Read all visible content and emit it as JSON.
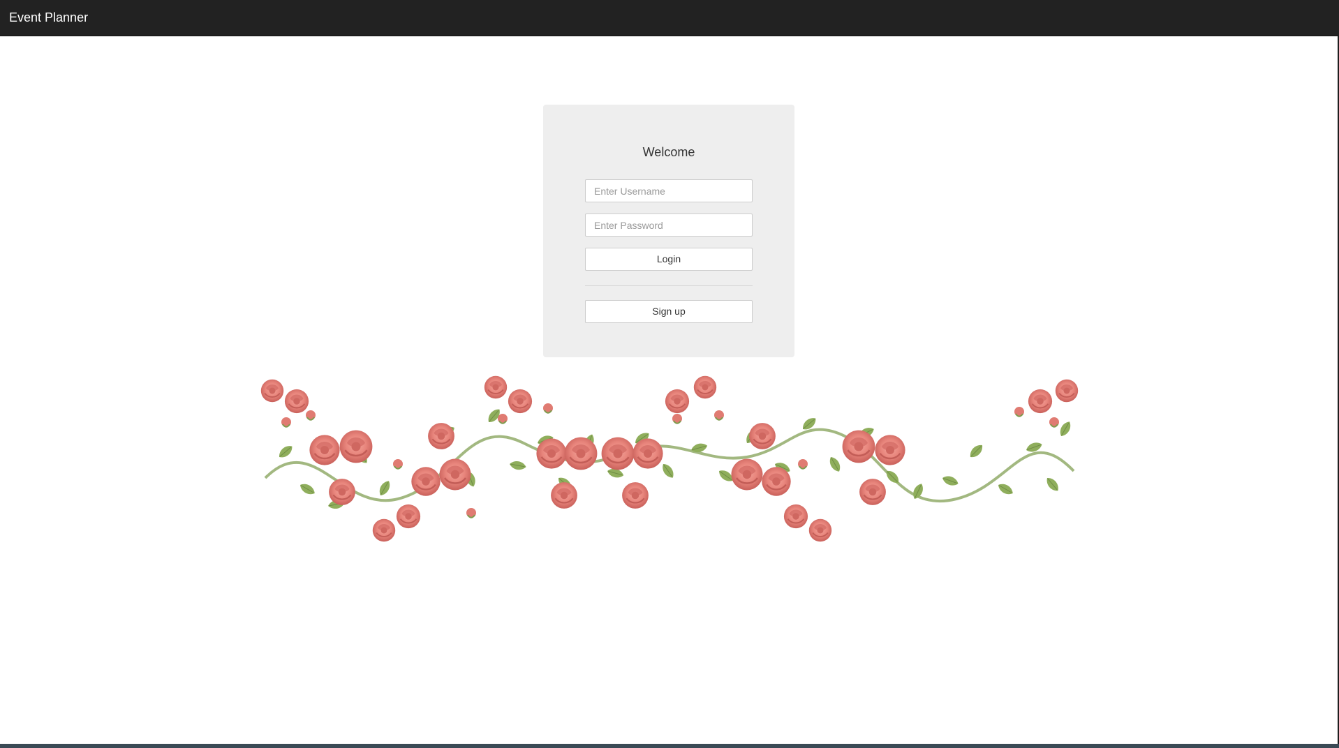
{
  "app": {
    "title": "Event Planner"
  },
  "login": {
    "heading": "Welcome",
    "username_placeholder": "Enter Username",
    "password_placeholder": "Enter Password",
    "login_label": "Login",
    "signup_label": "Sign up"
  },
  "decoration": {
    "icon": "rose-garland-icon",
    "rose_color": "#e8857c",
    "leaf_color": "#8fae5c"
  },
  "colors": {
    "topbar": "#222222",
    "panel": "#eeeeee"
  }
}
